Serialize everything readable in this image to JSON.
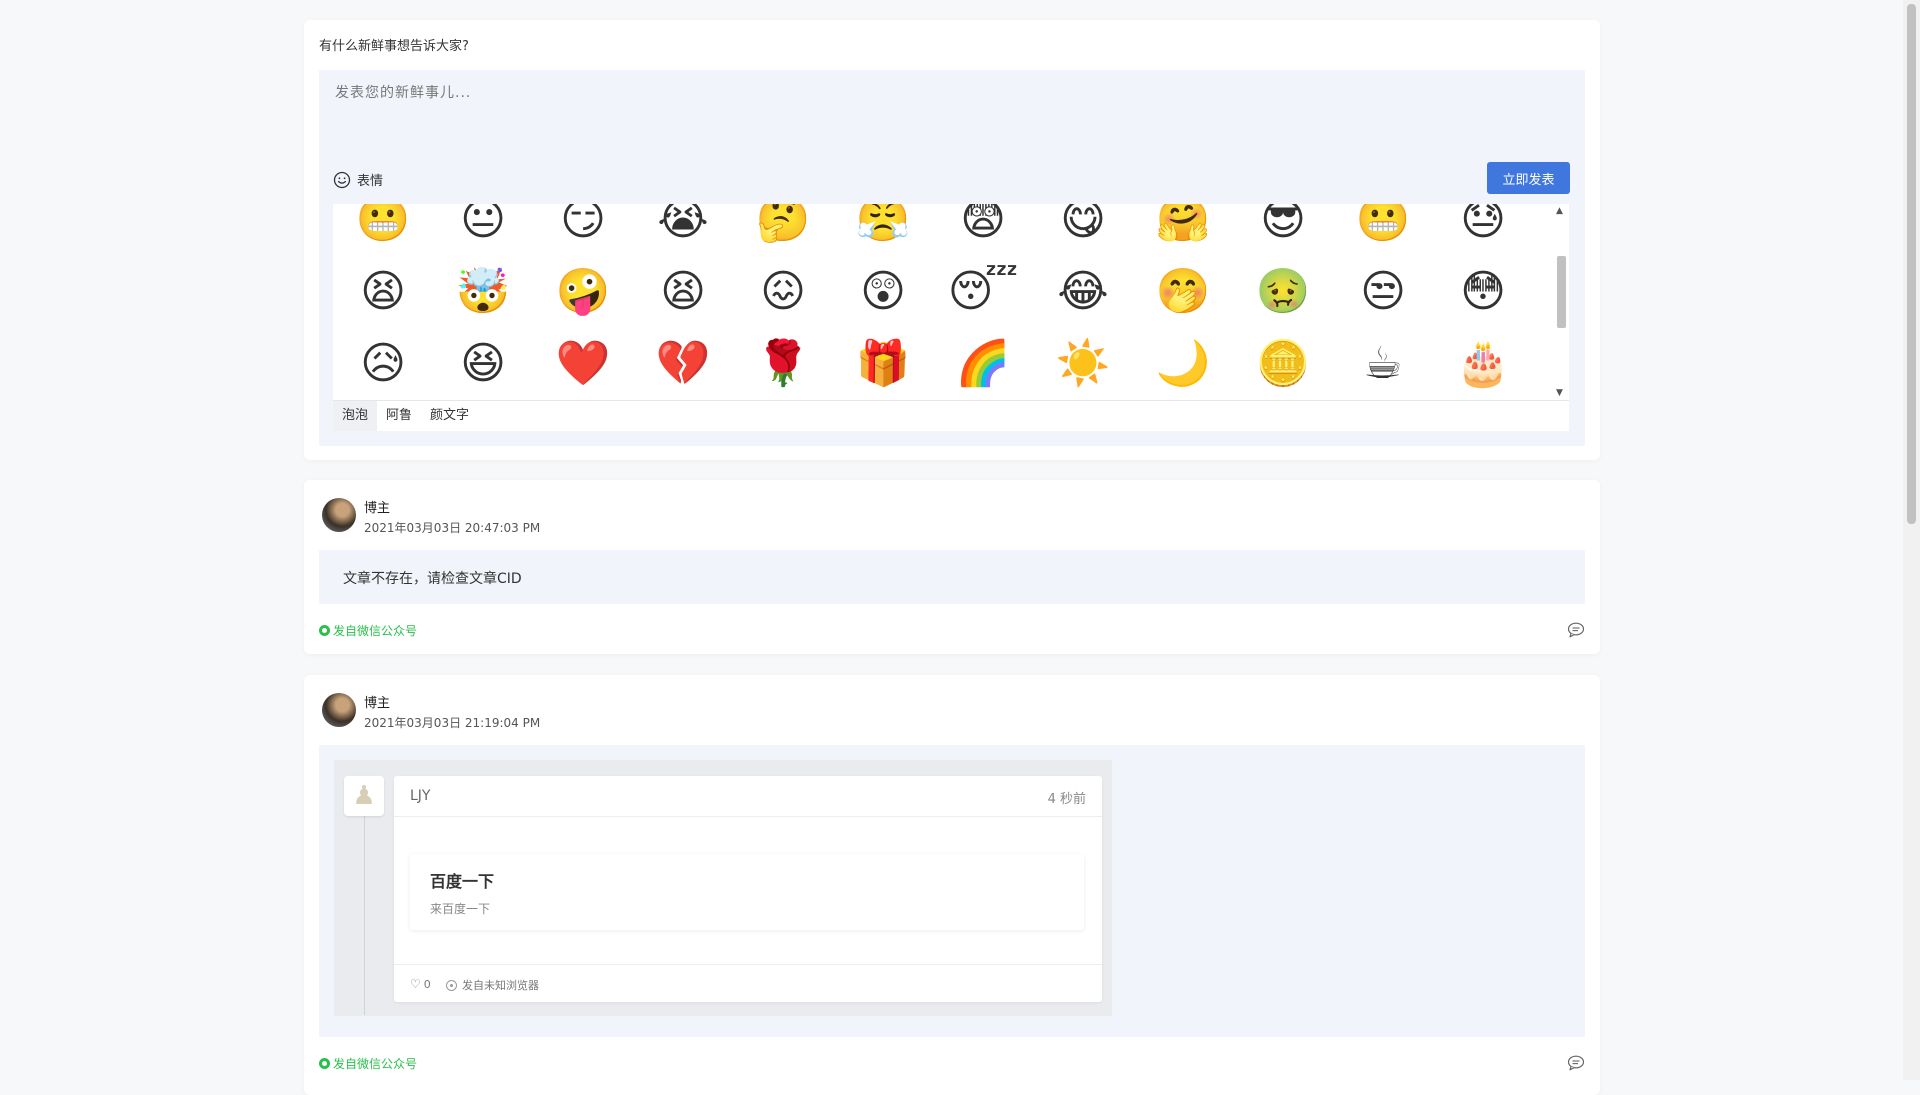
{
  "composer": {
    "title": "有什么新鲜事想告诉大家?",
    "placeholder": "发表您的新鲜事儿...",
    "emoji_label": "表情",
    "publish_label": "立即发表"
  },
  "emoji_panel": {
    "emojis": [
      "😬",
      "😐",
      "😏",
      "😭",
      "🤔",
      "😤",
      "😨",
      "😋",
      "🤗",
      "😎",
      "😬",
      "😓",
      "😫",
      "🤯",
      "🤪",
      "😫",
      "😖",
      "😲",
      "😴",
      "😂",
      "🤭",
      "🤢",
      "😒",
      "😳",
      "😥",
      "😆",
      "❤️",
      "💔",
      "🌹",
      "🎁",
      "🌈",
      "☀️",
      "🌙",
      "🪙",
      "☕",
      "🎂"
    ],
    "tabs": [
      "泡泡",
      "阿鲁",
      "颜文字"
    ],
    "active_tab": "泡泡"
  },
  "posts": [
    {
      "author": "博主",
      "time": "2021年03月03日 20:47:03 PM",
      "text": "文章不存在，请检查文章CID",
      "source": "发自微信公众号"
    },
    {
      "author": "博主",
      "time": "2021年03月03日 21:19:04 PM",
      "quote": {
        "name": "LJY",
        "time": "4 秒前",
        "link_title": "百度一下",
        "link_desc": "来百度一下",
        "likes": "0",
        "browser": "发自未知浏览器"
      },
      "source": "发自微信公众号"
    }
  ],
  "colors": {
    "accent": "#3f77de",
    "wechat_green": "#2bbf4b",
    "panel_bg": "#f1f4fb"
  }
}
